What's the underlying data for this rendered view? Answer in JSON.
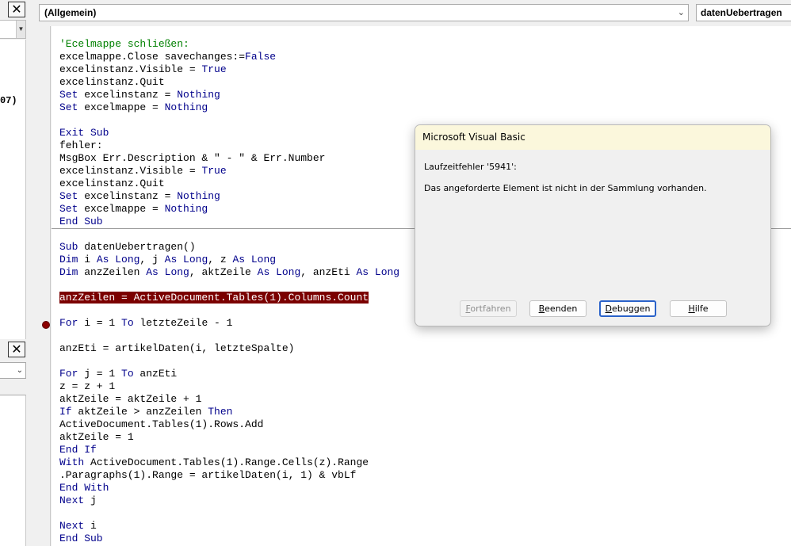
{
  "left_panel": {
    "top_close_glyph": "✕",
    "top_pane_text": "07)",
    "bottom_close_glyph": "✕",
    "combo_arrow_glyph": "⌄"
  },
  "code_window": {
    "object_combo": "(Allgemein)",
    "procedure_combo": "datenUebertragen",
    "code_lines": [
      [
        {
          "t": "'Ecelmappe schließen:",
          "c": "cm"
        }
      ],
      [
        {
          "t": "excelmappe.Close savechanges:=",
          "c": ""
        },
        {
          "t": "False",
          "c": "kw"
        }
      ],
      [
        {
          "t": "excelinstanz.Visible = ",
          "c": ""
        },
        {
          "t": "True",
          "c": "kw"
        }
      ],
      [
        {
          "t": "excelinstanz.Quit",
          "c": ""
        }
      ],
      [
        {
          "t": "Set",
          "c": "kw"
        },
        {
          "t": " excelinstanz = ",
          "c": ""
        },
        {
          "t": "Nothing",
          "c": "kw"
        }
      ],
      [
        {
          "t": "Set",
          "c": "kw"
        },
        {
          "t": " excelmappe = ",
          "c": ""
        },
        {
          "t": "Nothing",
          "c": "kw"
        }
      ],
      [],
      [
        {
          "t": "Exit Sub",
          "c": "kw"
        }
      ],
      [
        {
          "t": "fehler:",
          "c": ""
        }
      ],
      [
        {
          "t": "MsgBox Err.Description & \" - \" & Err.Number",
          "c": ""
        }
      ],
      [
        {
          "t": "excelinstanz.Visible = ",
          "c": ""
        },
        {
          "t": "True",
          "c": "kw"
        }
      ],
      [
        {
          "t": "excelinstanz.Quit",
          "c": ""
        }
      ],
      [
        {
          "t": "Set",
          "c": "kw"
        },
        {
          "t": " excelinstanz = ",
          "c": ""
        },
        {
          "t": "Nothing",
          "c": "kw"
        }
      ],
      [
        {
          "t": "Set",
          "c": "kw"
        },
        {
          "t": " excelmappe = ",
          "c": ""
        },
        {
          "t": "Nothing",
          "c": "kw"
        }
      ],
      [
        {
          "t": "End Sub",
          "c": "kw"
        }
      ],
      [],
      [
        {
          "t": "Sub",
          "c": "kw"
        },
        {
          "t": " datenUebertragen()",
          "c": ""
        }
      ],
      [
        {
          "t": "Dim",
          "c": "kw"
        },
        {
          "t": " i ",
          "c": ""
        },
        {
          "t": "As Long",
          "c": "kw"
        },
        {
          "t": ", j ",
          "c": ""
        },
        {
          "t": "As Long",
          "c": "kw"
        },
        {
          "t": ", z ",
          "c": ""
        },
        {
          "t": "As Long",
          "c": "kw"
        }
      ],
      [
        {
          "t": "Dim",
          "c": "kw"
        },
        {
          "t": " anzZeilen ",
          "c": ""
        },
        {
          "t": "As Long",
          "c": "kw"
        },
        {
          "t": ", aktZeile ",
          "c": ""
        },
        {
          "t": "As Long",
          "c": "kw"
        },
        {
          "t": ", anzEti ",
          "c": ""
        },
        {
          "t": "As Long",
          "c": "kw"
        }
      ],
      [],
      [
        {
          "t": "anzZeilen = ActiveDocument.Tables(1).Columns.Count",
          "c": "hl"
        }
      ],
      [],
      [
        {
          "t": "For",
          "c": "kw"
        },
        {
          "t": " i = 1 ",
          "c": ""
        },
        {
          "t": "To",
          "c": "kw"
        },
        {
          "t": " letzteZeile - 1",
          "c": ""
        }
      ],
      [],
      [
        {
          "t": "anzEti = artikelDaten(i, letzteSpalte)",
          "c": ""
        }
      ],
      [],
      [
        {
          "t": "For",
          "c": "kw"
        },
        {
          "t": " j = 1 ",
          "c": ""
        },
        {
          "t": "To",
          "c": "kw"
        },
        {
          "t": " anzEti",
          "c": ""
        }
      ],
      [
        {
          "t": "z = z + 1",
          "c": ""
        }
      ],
      [
        {
          "t": "aktZeile = aktZeile + 1",
          "c": ""
        }
      ],
      [
        {
          "t": "If",
          "c": "kw"
        },
        {
          "t": " aktZeile > anzZeilen ",
          "c": ""
        },
        {
          "t": "Then",
          "c": "kw"
        }
      ],
      [
        {
          "t": "ActiveDocument.Tables(1).Rows.Add",
          "c": ""
        }
      ],
      [
        {
          "t": "aktZeile = 1",
          "c": ""
        }
      ],
      [
        {
          "t": "End If",
          "c": "kw"
        }
      ],
      [
        {
          "t": "With",
          "c": "kw"
        },
        {
          "t": " ActiveDocument.Tables(1).Range.Cells(z).Range",
          "c": ""
        }
      ],
      [
        {
          "t": ".Paragraphs(1).Range = artikelDaten(i, 1) & vbLf",
          "c": ""
        }
      ],
      [
        {
          "t": "End With",
          "c": "kw"
        }
      ],
      [
        {
          "t": "Next",
          "c": "kw"
        },
        {
          "t": " j",
          "c": ""
        }
      ],
      [],
      [
        {
          "t": "Next",
          "c": "kw"
        },
        {
          "t": " i",
          "c": ""
        }
      ],
      [
        {
          "t": "End Sub",
          "c": "kw"
        }
      ]
    ]
  },
  "dialog": {
    "title": "Microsoft Visual Basic",
    "error_code": "Laufzeitfehler '5941':",
    "message": "Das angeforderte Element ist nicht in der Sammlung vorhanden.",
    "buttons": {
      "continue": {
        "accel": "F",
        "rest": "ortfahren"
      },
      "end": {
        "accel": "B",
        "rest": "eenden"
      },
      "debug": {
        "accel": "D",
        "rest": "ebuggen"
      },
      "help": {
        "accel": "H",
        "rest": "ilfe"
      }
    }
  },
  "colors": {
    "keyword": "#00008b",
    "comment": "#008000",
    "error_highlight": "#7b0000",
    "breakpoint": "#8b0000",
    "dialog_title_bg": "#fbf7dc",
    "default_button_border": "#2a62c9"
  }
}
